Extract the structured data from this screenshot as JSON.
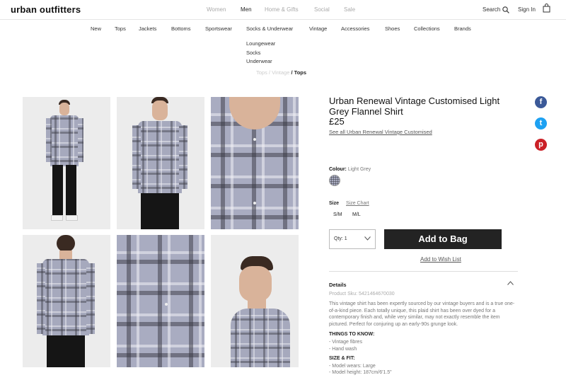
{
  "header": {
    "logo": "urban outfitters",
    "gender_tabs": [
      {
        "label": "Women",
        "active": false
      },
      {
        "label": "Men",
        "active": true
      },
      {
        "label": "Home & Gifts",
        "active": false
      },
      {
        "label": "Social",
        "active": false
      },
      {
        "label": "Sale",
        "active": false
      }
    ],
    "search_label": "Search",
    "signin_label": "Sign In",
    "icons": {
      "search": "search-icon",
      "bag": "shopping-bag-icon"
    }
  },
  "category_nav": [
    "New",
    "Tops",
    "Jackets",
    "Bottoms",
    "Sportswear",
    "Socks & Underwear",
    "Vintage",
    "Accessories",
    "Shoes",
    "Collections",
    "Brands"
  ],
  "dropdown": [
    "Loungewear",
    "Socks",
    "Underwear"
  ],
  "breadcrumb": {
    "hidden_part": "Tops / Vintage",
    "current": "/ Tops"
  },
  "product": {
    "title": "Urban Renewal Vintage Customised Light Grey Flannel Shirt",
    "price": "£25",
    "see_all": "See all Urban Renewal Vintage Customised",
    "colour_label": "Colour:",
    "colour_value": "Light Grey",
    "size_label": "Size",
    "size_chart": "Size Chart",
    "sizes": [
      "S/M",
      "M/L"
    ],
    "qty": "Qty: 1",
    "add_to_bag": "Add to Bag",
    "wish_list": "Add to Wish List"
  },
  "details": {
    "heading": "Details",
    "sku": "Product Sku: 5421464670030",
    "description": "This vintage shirt has been expertly sourced by our vintage buyers and is a true one-of-a-kind piece. Each totally unique, this plaid shirt has been over dyed for a contemporary finish and, while very similar, may not exactly resemble the item pictured. Perfect for conjuring up an early-90s grunge look.",
    "things_heading": "THINGS TO KNOW:",
    "things": [
      "- Vintage fibres",
      "- Hand wash"
    ],
    "fit_heading": "SIZE & FIT:",
    "fit": [
      "- Model wears: Large",
      "- Model height: 187cm/6'1.5\""
    ]
  },
  "social": [
    {
      "name": "facebook-icon",
      "glyph": "f",
      "color": "#3b5998"
    },
    {
      "name": "twitter-icon",
      "glyph": "t",
      "color": "#1da1f2"
    },
    {
      "name": "pinterest-icon",
      "glyph": "p",
      "color": "#cb2027"
    }
  ],
  "colors": {
    "accent_button": "#232323",
    "swatch": "#a9acc1"
  }
}
